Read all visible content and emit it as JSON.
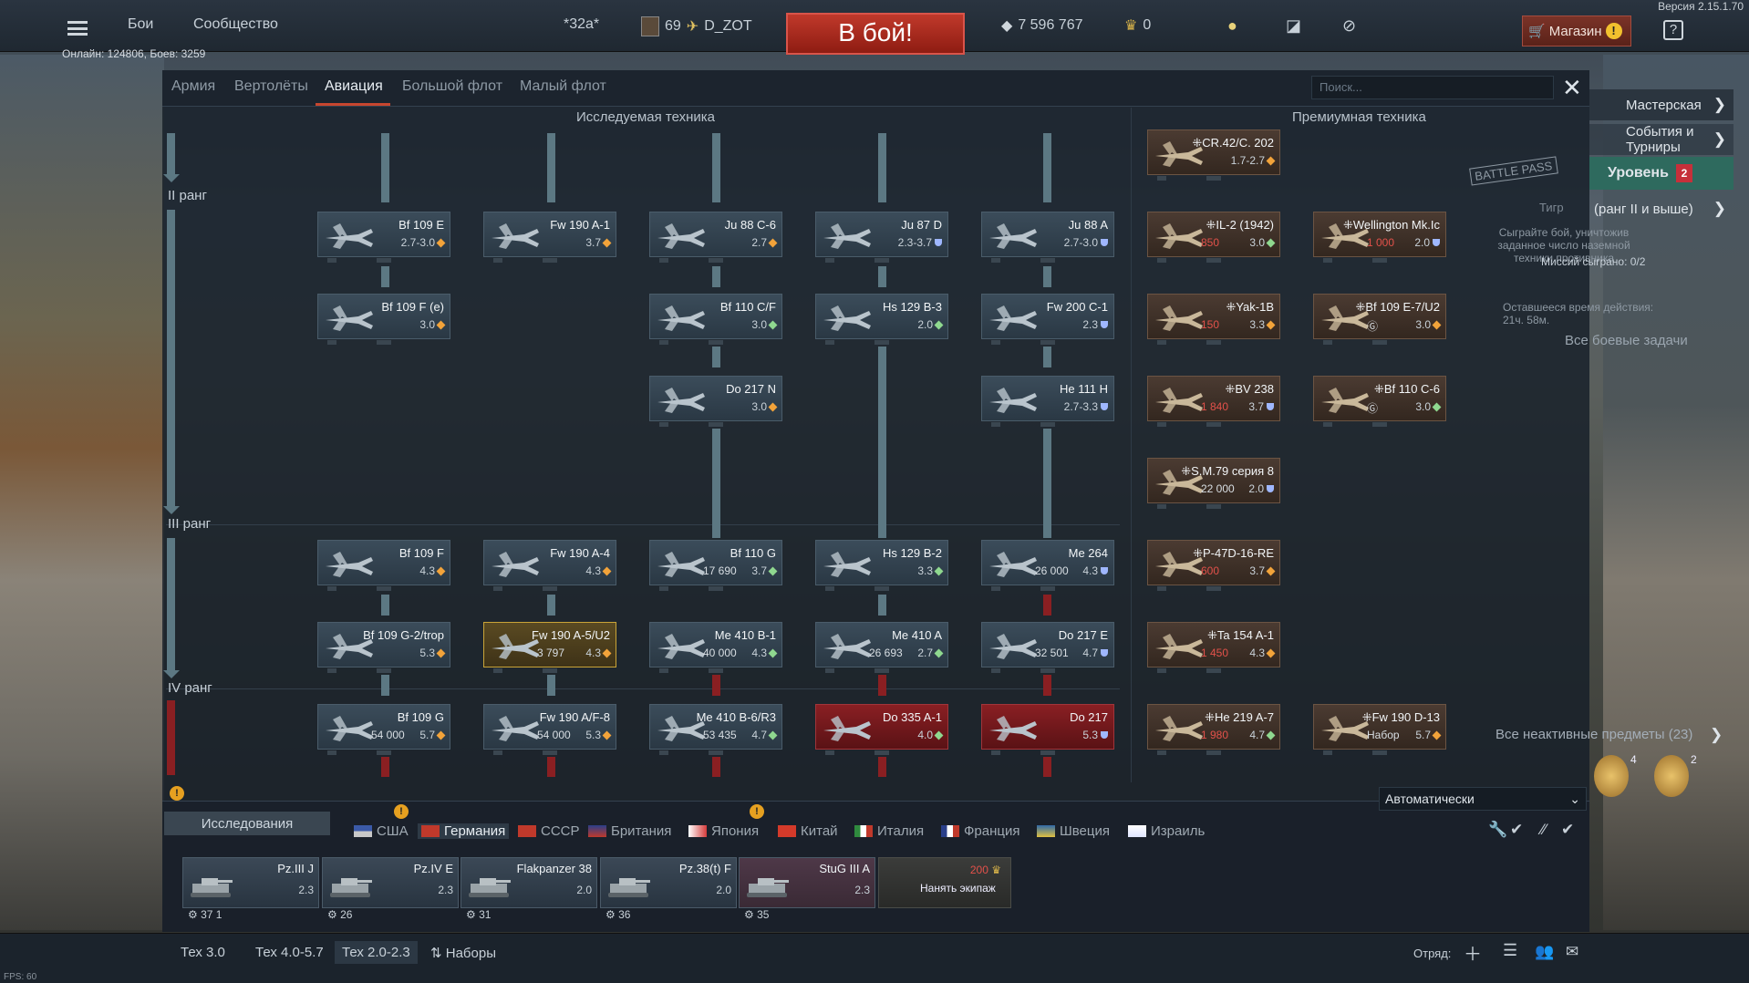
{
  "version": "Версия 2.15.1.70",
  "top": {
    "battles": "Бои",
    "community": "Сообщество",
    "squad": "*32а*",
    "level": "69",
    "nick": "D_ZOT",
    "battle_button": "В бой!",
    "silver": "7 596 767",
    "gold": "0",
    "shop": "Магазин",
    "help": "?"
  },
  "online": "Онлайн: 124806, Боев: 3259",
  "tabs": [
    "Армия",
    "Вертолёты",
    "Авиация",
    "Большой флот",
    "Малый флот"
  ],
  "search_placeholder": "Поиск...",
  "sections": {
    "research": "Исследуемая техника",
    "premium": "Премиумная техника"
  },
  "ranks": {
    "r2": "II ранг",
    "r3": "III ранг",
    "r4": "IV ранг"
  },
  "cards": [
    {
      "name": "Bf 109 E",
      "br": "2.7-3.0",
      "mark": "o"
    },
    {
      "name": "Fw 190 A-1",
      "br": "3.7",
      "mark": "o"
    },
    {
      "name": "Ju 88 C-6",
      "br": "2.7",
      "mark": "o"
    },
    {
      "name": "Ju 87 D",
      "br": "2.3-3.7",
      "mark": "b"
    },
    {
      "name": "Ju 88 A",
      "br": "2.7-3.0",
      "mark": "b"
    },
    {
      "name": "Bf 109 F (e)",
      "br": "3.0",
      "mark": "o"
    },
    {
      "name": "Bf 110 C/F",
      "br": "3.0",
      "mark": "g"
    },
    {
      "name": "Hs 129 B-3",
      "br": "2.0",
      "mark": "g"
    },
    {
      "name": "Fw 200 C-1",
      "br": "2.3",
      "mark": "b"
    },
    {
      "name": "Do 217 N",
      "br": "3.0",
      "mark": "o"
    },
    {
      "name": "He 111 H",
      "br": "2.7-3.3",
      "mark": "b"
    },
    {
      "name": "Bf 109 F",
      "br": "4.3",
      "mark": "o"
    },
    {
      "name": "Fw 190 A-4",
      "br": "4.3",
      "mark": "o"
    },
    {
      "name": "Bf 110 G",
      "br": "3.7",
      "mark": "g",
      "price": "17 690"
    },
    {
      "name": "Hs 129 B-2",
      "br": "3.3",
      "mark": "g"
    },
    {
      "name": "Me 264",
      "br": "4.3",
      "mark": "b",
      "price": "26 000"
    },
    {
      "name": "Bf 109 G-2/trop",
      "br": "5.3",
      "mark": "o"
    },
    {
      "name": "Fw 190 A-5/U2",
      "br": "4.3",
      "mark": "o",
      "price": "3 797"
    },
    {
      "name": "Me 410 B-1",
      "br": "4.3",
      "mark": "g",
      "price": "40 000"
    },
    {
      "name": "Me 410 A",
      "br": "2.7",
      "mark": "g",
      "price": "26 693"
    },
    {
      "name": "Do 217 E",
      "br": "4.7",
      "mark": "b",
      "price": "32 501"
    },
    {
      "name": "Bf 109 G",
      "br": "5.7",
      "mark": "o",
      "price": "54 000"
    },
    {
      "name": "Fw 190 A/F-8",
      "br": "5.3",
      "mark": "o",
      "price": "54 000"
    },
    {
      "name": "Me 410 B-6/R3",
      "br": "4.7",
      "mark": "g",
      "price": "53 435"
    },
    {
      "name": "Do 335 A-1",
      "br": "4.0",
      "mark": "g"
    },
    {
      "name": "Do 217",
      "br": "5.3",
      "mark": "b"
    }
  ],
  "premium": [
    {
      "name": "CR.42/C. 202",
      "br": "1.7-2.7",
      "mark": "o"
    },
    {
      "name": "IL-2 (1942)",
      "br": "3.0",
      "mark": "g",
      "price": "850"
    },
    {
      "name": "Wellington Mk.Ic",
      "br": "2.0",
      "mark": "b",
      "price": "1 000"
    },
    {
      "name": "Yak-1B",
      "br": "3.3",
      "mark": "o",
      "price": "150"
    },
    {
      "name": "Bf 109 E-7/U2",
      "br": "3.0",
      "mark": "o",
      "price": "Ⓖ"
    },
    {
      "name": "BV 238",
      "br": "3.7",
      "mark": "b",
      "price": "1 840"
    },
    {
      "name": "Bf 110 C-6",
      "br": "3.0",
      "mark": "g",
      "price": "Ⓖ"
    },
    {
      "name": "S.M.79 серия 8",
      "br": "2.0",
      "mark": "b",
      "price": "22 000"
    },
    {
      "name": "P-47D-16-RE",
      "br": "3.7",
      "mark": "o",
      "price": "600"
    },
    {
      "name": "Ta 154 A-1",
      "br": "4.3",
      "mark": "o",
      "price": "1 450"
    },
    {
      "name": "He 219 A-7",
      "br": "4.7",
      "mark": "g",
      "price": "1 980"
    },
    {
      "name": "Fw 190 D-13",
      "br": "5.7",
      "mark": "o",
      "price": "Набор"
    }
  ],
  "right": {
    "workshop": "Мастерская",
    "events": "События и Турниры",
    "level": "Уровень",
    "level_badge": "2",
    "battlepass": "BATTLE PASS",
    "tier": "Тигр",
    "rank_req": "(ранг II и выше)",
    "task": "Сыграйте бой, уничтожив заданное число наземной техники противника",
    "played": "Миссий сыграно: 0/2",
    "left": "Оставшееся время действия: 21ч. 58м.",
    "all_tasks": "Все боевые задачи",
    "inactive": "Все неактивные предметы (23)",
    "m1": "4",
    "m2": "2"
  },
  "research": "Исследования",
  "nations": [
    "США",
    "Германия",
    "СССР",
    "Британия",
    "Япония",
    "Китай",
    "Италия",
    "Франция",
    "Швеция",
    "Израиль"
  ],
  "auto": "Автоматически",
  "tanks": [
    {
      "name": "Pz.III J",
      "br": "2.3",
      "num": "37",
      "ext": "1"
    },
    {
      "name": "Pz.IV E",
      "br": "2.3",
      "num": "26"
    },
    {
      "name": "Flakpanzer 38",
      "br": "2.0",
      "num": "31"
    },
    {
      "name": "Pz.38(t) F",
      "br": "2.0",
      "num": "36"
    },
    {
      "name": "StuG III A",
      "br": "2.3",
      "num": "35"
    }
  ],
  "crew": {
    "price": "200",
    "label": "Нанять экипаж"
  },
  "presets": [
    "Тех 3.0",
    "Тех 4.0-5.7",
    "Тех 2.0-2.3",
    "Наборы"
  ],
  "squad_label": "Отряд:",
  "fps": "FPS: 60"
}
